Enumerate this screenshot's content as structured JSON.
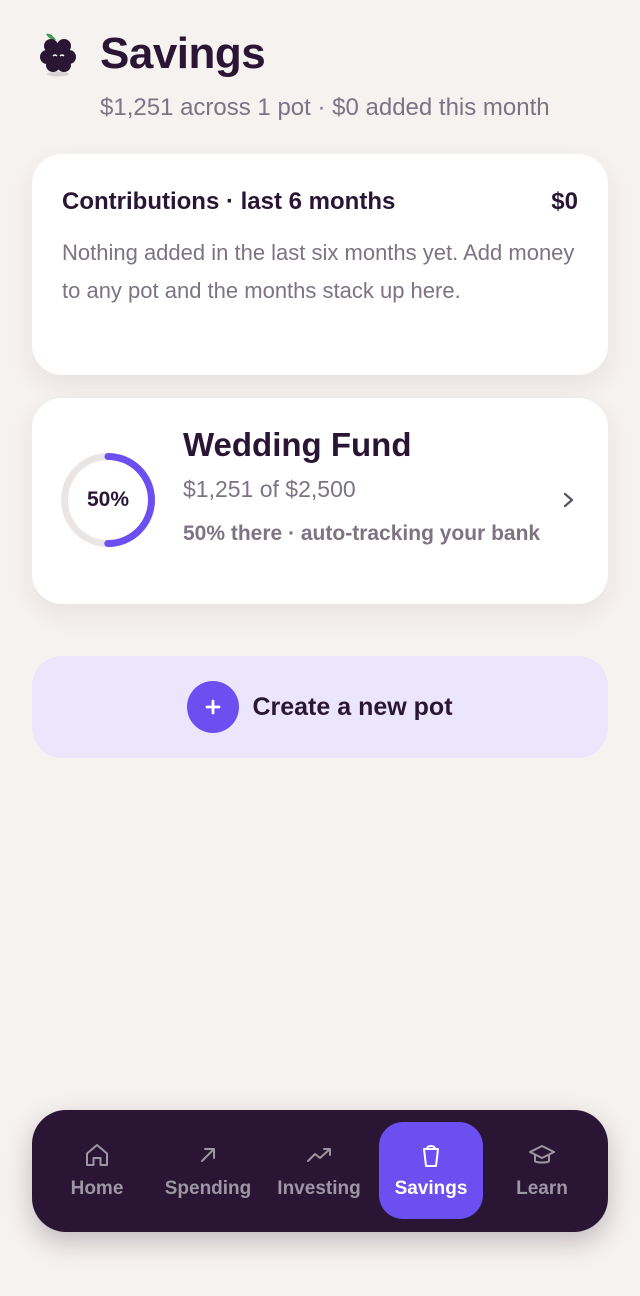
{
  "header": {
    "logo_icon": "blackberry-logo-icon",
    "title": "Savings",
    "subtitle": "$1,251 across 1 pot · $0 added this month"
  },
  "contributions": {
    "title": "Contributions · last 6 months",
    "total": "$0",
    "empty_message": "Nothing added in the last six months yet. Add money to any pot and the months stack up here."
  },
  "pots": [
    {
      "name": "Wedding Fund",
      "progress_label": "50%",
      "progress": 0.5,
      "amount": "$1,251 of $2,500",
      "status": "50% there · auto-tracking your bank",
      "icon": "chevron-right-icon"
    }
  ],
  "create_pot": {
    "label": "Create a new pot",
    "icon": "plus-icon"
  },
  "nav": {
    "items": [
      {
        "label": "Home",
        "icon": "home-icon",
        "active": false
      },
      {
        "label": "Spending",
        "icon": "arrow-up-right-icon",
        "active": false
      },
      {
        "label": "Investing",
        "icon": "trending-up-icon",
        "active": false
      },
      {
        "label": "Savings",
        "icon": "cup-icon",
        "active": true
      },
      {
        "label": "Learn",
        "icon": "graduation-cap-icon",
        "active": false
      }
    ]
  },
  "colors": {
    "background": "#f6f2ef",
    "ink": "#2a1634",
    "muted": "#7d7383",
    "accent": "#6b4ff0",
    "accent_soft": "#ebe6fb",
    "nav_bg": "#2a1634",
    "ring_track": "#ebe6e6"
  }
}
